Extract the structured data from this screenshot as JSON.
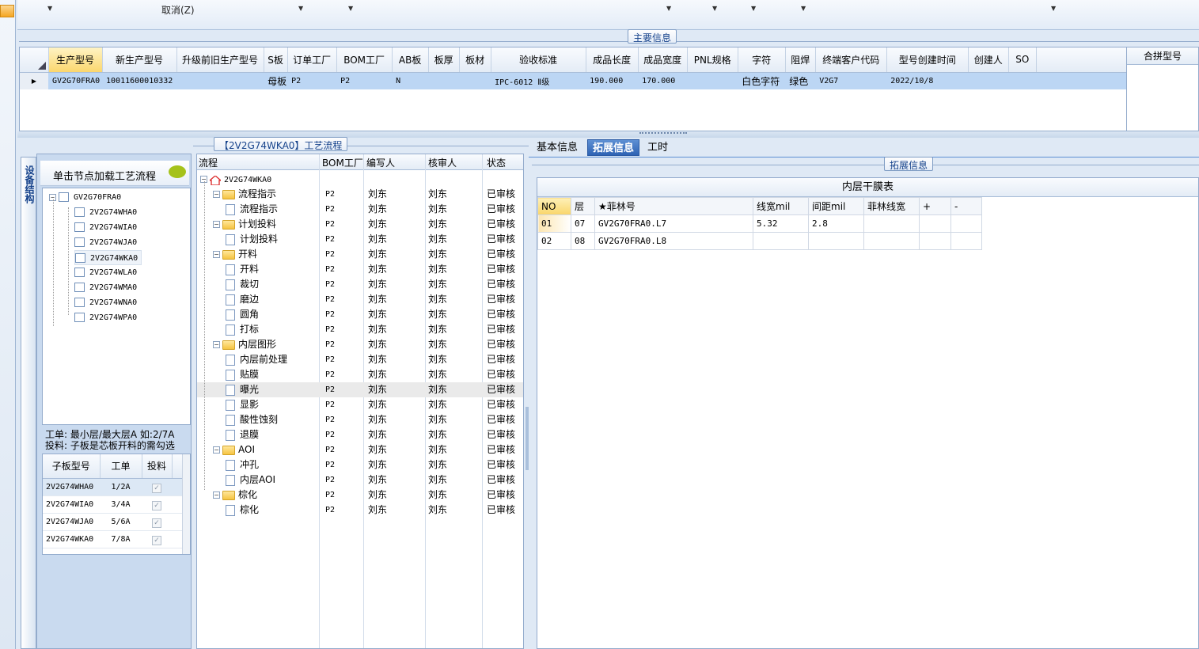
{
  "toolbar": {
    "cancel_label": "取消(Z)"
  },
  "main_info": {
    "legend": "主要信息",
    "columns": [
      "生产型号",
      "新生产型号",
      "升级前旧生产型号",
      "S板",
      "订单工厂",
      "BOM工厂",
      "AB板",
      "板厚",
      "板材",
      "验收标准",
      "成品长度",
      "成品宽度",
      "PNL规格",
      "字符",
      "阻焊",
      "终端客户代码",
      "型号创建时间",
      "创建人",
      "SO"
    ],
    "row": [
      "GV2G70FRA0",
      "10011600010332",
      "",
      "母板",
      "P2",
      "P2",
      "N",
      "",
      "",
      "IPC-6012 Ⅱ级",
      "190.000",
      "170.000",
      "",
      "白色字符",
      "绿色",
      "V2G7",
      "2022/10/8",
      "",
      ""
    ],
    "merge_header": "合拼型号"
  },
  "left_panel": {
    "vertical_tab": "设备结构",
    "hint": "单击节点加载工艺流程",
    "tree_root": "GV2G70FRA0",
    "tree_children": [
      "2V2G74WHA0",
      "2V2G74WIA0",
      "2V2G74WJA0",
      "2V2G74WKA0",
      "2V2G74WLA0",
      "2V2G74WMA0",
      "2V2G74WNA0",
      "2V2G74WPA0"
    ],
    "note1": "工单: 最小层/最大层A 如:2/7A",
    "note2": "投料: 子板是芯板开料的需勾选",
    "sub_columns": [
      "子板型号",
      "工单",
      "投料"
    ],
    "sub_rows": [
      [
        "2V2G74WHA0",
        "1/2A"
      ],
      [
        "2V2G74WIA0",
        "3/4A"
      ],
      [
        "2V2G74WJA0",
        "5/6A"
      ],
      [
        "2V2G74WKA0",
        "7/8A"
      ]
    ]
  },
  "process": {
    "legend": "【2V2G74WKA0】工艺流程",
    "columns": [
      "流程",
      "BOM工厂",
      "编写人",
      "核审人",
      "状态"
    ],
    "root": "2V2G74WKA0",
    "rows": [
      {
        "name": "流程指示",
        "lvl": 1,
        "folder": true,
        "factory": "P2",
        "writer": "刘东",
        "reviewer": "刘东",
        "status": "已审核"
      },
      {
        "name": "流程指示",
        "lvl": 2,
        "folder": false,
        "factory": "P2",
        "writer": "刘东",
        "reviewer": "刘东",
        "status": "已审核"
      },
      {
        "name": "计划投料",
        "lvl": 1,
        "folder": true,
        "factory": "P2",
        "writer": "刘东",
        "reviewer": "刘东",
        "status": "已审核"
      },
      {
        "name": "计划投料",
        "lvl": 2,
        "folder": false,
        "factory": "P2",
        "writer": "刘东",
        "reviewer": "刘东",
        "status": "已审核"
      },
      {
        "name": "开料",
        "lvl": 1,
        "folder": true,
        "factory": "P2",
        "writer": "刘东",
        "reviewer": "刘东",
        "status": "已审核"
      },
      {
        "name": "开料",
        "lvl": 2,
        "folder": false,
        "factory": "P2",
        "writer": "刘东",
        "reviewer": "刘东",
        "status": "已审核"
      },
      {
        "name": "裁切",
        "lvl": 2,
        "folder": false,
        "factory": "P2",
        "writer": "刘东",
        "reviewer": "刘东",
        "status": "已审核"
      },
      {
        "name": "磨边",
        "lvl": 2,
        "folder": false,
        "factory": "P2",
        "writer": "刘东",
        "reviewer": "刘东",
        "status": "已审核"
      },
      {
        "name": "圆角",
        "lvl": 2,
        "folder": false,
        "factory": "P2",
        "writer": "刘东",
        "reviewer": "刘东",
        "status": "已审核"
      },
      {
        "name": "打标",
        "lvl": 2,
        "folder": false,
        "factory": "P2",
        "writer": "刘东",
        "reviewer": "刘东",
        "status": "已审核"
      },
      {
        "name": "内层图形",
        "lvl": 1,
        "folder": true,
        "factory": "P2",
        "writer": "刘东",
        "reviewer": "刘东",
        "status": "已审核"
      },
      {
        "name": "内层前处理",
        "lvl": 2,
        "folder": false,
        "factory": "P2",
        "writer": "刘东",
        "reviewer": "刘东",
        "status": "已审核"
      },
      {
        "name": "贴膜",
        "lvl": 2,
        "folder": false,
        "factory": "P2",
        "writer": "刘东",
        "reviewer": "刘东",
        "status": "已审核"
      },
      {
        "name": "曝光",
        "lvl": 2,
        "folder": false,
        "factory": "P2",
        "writer": "刘东",
        "reviewer": "刘东",
        "status": "已审核",
        "selected": true
      },
      {
        "name": "显影",
        "lvl": 2,
        "folder": false,
        "factory": "P2",
        "writer": "刘东",
        "reviewer": "刘东",
        "status": "已审核"
      },
      {
        "name": "酸性蚀刻",
        "lvl": 2,
        "folder": false,
        "factory": "P2",
        "writer": "刘东",
        "reviewer": "刘东",
        "status": "已审核"
      },
      {
        "name": "退膜",
        "lvl": 2,
        "folder": false,
        "factory": "P2",
        "writer": "刘东",
        "reviewer": "刘东",
        "status": "已审核"
      },
      {
        "name": "AOI",
        "lvl": 1,
        "folder": true,
        "factory": "P2",
        "writer": "刘东",
        "reviewer": "刘东",
        "status": "已审核"
      },
      {
        "name": "冲孔",
        "lvl": 2,
        "folder": false,
        "factory": "P2",
        "writer": "刘东",
        "reviewer": "刘东",
        "status": "已审核"
      },
      {
        "name": "内层AOI",
        "lvl": 2,
        "folder": false,
        "factory": "P2",
        "writer": "刘东",
        "reviewer": "刘东",
        "status": "已审核"
      },
      {
        "name": "棕化",
        "lvl": 1,
        "folder": true,
        "factory": "P2",
        "writer": "刘东",
        "reviewer": "刘东",
        "status": "已审核"
      },
      {
        "name": "棕化",
        "lvl": 2,
        "folder": false,
        "factory": "P2",
        "writer": "刘东",
        "reviewer": "刘东",
        "status": "已审核"
      }
    ]
  },
  "tabs": [
    "基本信息",
    "拓展信息",
    "工时"
  ],
  "ext_info": {
    "legend": "拓展信息",
    "table_title": "内层干膜表",
    "columns": [
      "NO",
      "层",
      "★菲林号",
      "线宽mil",
      "间距mil",
      "菲林线宽",
      "+",
      "-"
    ],
    "rows": [
      [
        "01",
        "07",
        "GV2G70FRA0.L7",
        "5.32",
        "2.8",
        "",
        "",
        ""
      ],
      [
        "02",
        "08",
        "GV2G70FRA0.L8",
        "",
        "",
        "",
        "",
        ""
      ]
    ]
  }
}
